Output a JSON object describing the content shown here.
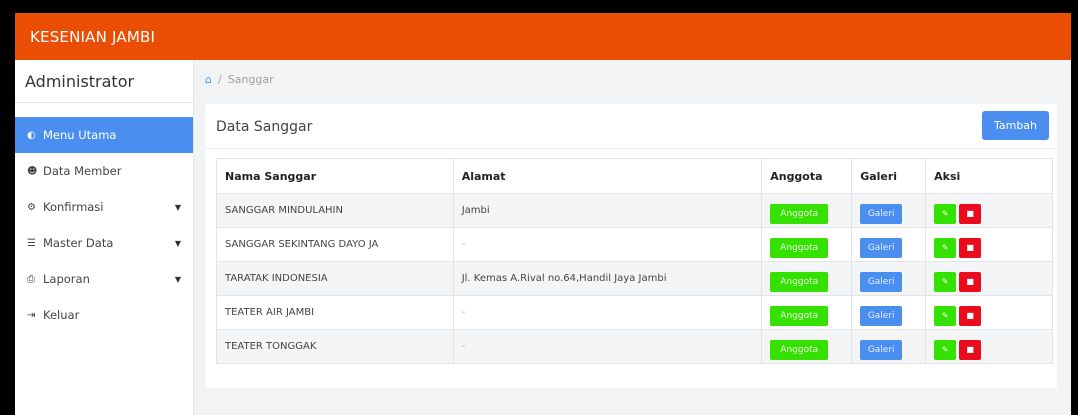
{
  "app": {
    "title": "KESENIAN JAMBI"
  },
  "sidebar": {
    "user": "Administrator",
    "items": [
      {
        "label": "Menu Utama",
        "icon": "dashboard-icon",
        "glyph": "◐",
        "active": true,
        "caret": false
      },
      {
        "label": "Data Member",
        "icon": "users-icon",
        "glyph": "☻",
        "active": false,
        "caret": false
      },
      {
        "label": "Konfirmasi",
        "icon": "gear-icon",
        "glyph": "⚙",
        "active": false,
        "caret": true
      },
      {
        "label": "Master Data",
        "icon": "database-icon",
        "glyph": "☰",
        "active": false,
        "caret": true
      },
      {
        "label": "Laporan",
        "icon": "print-icon",
        "glyph": "⎙",
        "active": false,
        "caret": true
      },
      {
        "label": "Keluar",
        "icon": "sign-out-icon",
        "glyph": "⇥",
        "active": false,
        "caret": false
      }
    ]
  },
  "breadcrumb": {
    "home_icon": "home-icon",
    "separator": "/",
    "current": "Sanggar"
  },
  "card": {
    "title": "Data Sanggar",
    "add_label": "Tambah"
  },
  "table": {
    "headers": [
      "Nama Sanggar",
      "Alamat",
      "Anggota",
      "Galeri",
      "Aksi"
    ],
    "rows": [
      {
        "nama": "SANGGAR MINDULAHIN",
        "alamat": "Jambi"
      },
      {
        "nama": "SANGGAR SEKINTANG DAYO JA",
        "alamat": "-"
      },
      {
        "nama": "TARATAK INDONESIA",
        "alamat": "Jl. Kemas A.Rival no.64,Handil Jaya Jambi"
      },
      {
        "nama": "TEATER AIR JAMBI",
        "alamat": "-"
      },
      {
        "nama": "TEATER TONGGAK",
        "alamat": "-"
      }
    ],
    "anggota_label": "Anggota",
    "galeri_label": "Galeri",
    "edit_icon": "edit-icon",
    "delete_icon": "trash-icon"
  },
  "colors": {
    "topbar": "#ea4e05",
    "primary": "#4a8ef0",
    "success": "#34e100",
    "danger": "#ea0c1c"
  }
}
